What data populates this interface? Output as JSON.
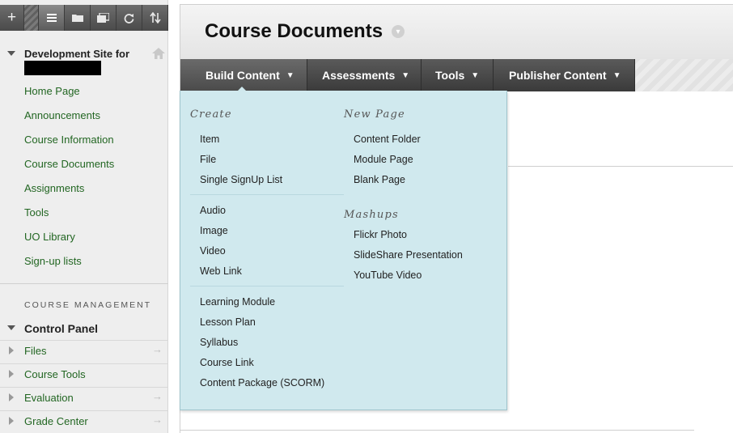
{
  "sidebar": {
    "toolbar": [
      "add-icon",
      "list-icon",
      "folder-icon",
      "window-icon",
      "refresh-icon",
      "sort-icon"
    ],
    "site_title": "Development Site for",
    "menu": [
      "Home Page",
      "Announcements",
      "Course Information",
      "Course Documents",
      "Assignments",
      "Tools",
      "UO Library",
      "Sign-up lists"
    ],
    "management_heading": "COURSE MANAGEMENT",
    "control_panel": "Control Panel",
    "control_items": [
      "Files",
      "Course Tools",
      "Evaluation",
      "Grade Center"
    ]
  },
  "page": {
    "title": "Course Documents"
  },
  "actionbar": {
    "tabs": [
      "Build Content",
      "Assessments",
      "Tools",
      "Publisher Content"
    ]
  },
  "dropdown": {
    "create_heading": "Create",
    "create_group1": [
      "Item",
      "File",
      "Single SignUp List"
    ],
    "create_group2": [
      "Audio",
      "Image",
      "Video",
      "Web Link"
    ],
    "create_group3": [
      "Learning Module",
      "Lesson Plan",
      "Syllabus",
      "Course Link",
      "Content Package (SCORM)"
    ],
    "newpage_heading": "New Page",
    "newpage_items": [
      "Content Folder",
      "Module Page",
      "Blank Page"
    ],
    "mashups_heading": "Mashups",
    "mashups_items": [
      "Flickr Photo",
      "SlideShare Presentation",
      "YouTube Video"
    ]
  },
  "colors": {
    "link_green": "#226622",
    "dropdown_bg": "#d0e9ee",
    "actionbar_dark": "#3a3a3a"
  }
}
